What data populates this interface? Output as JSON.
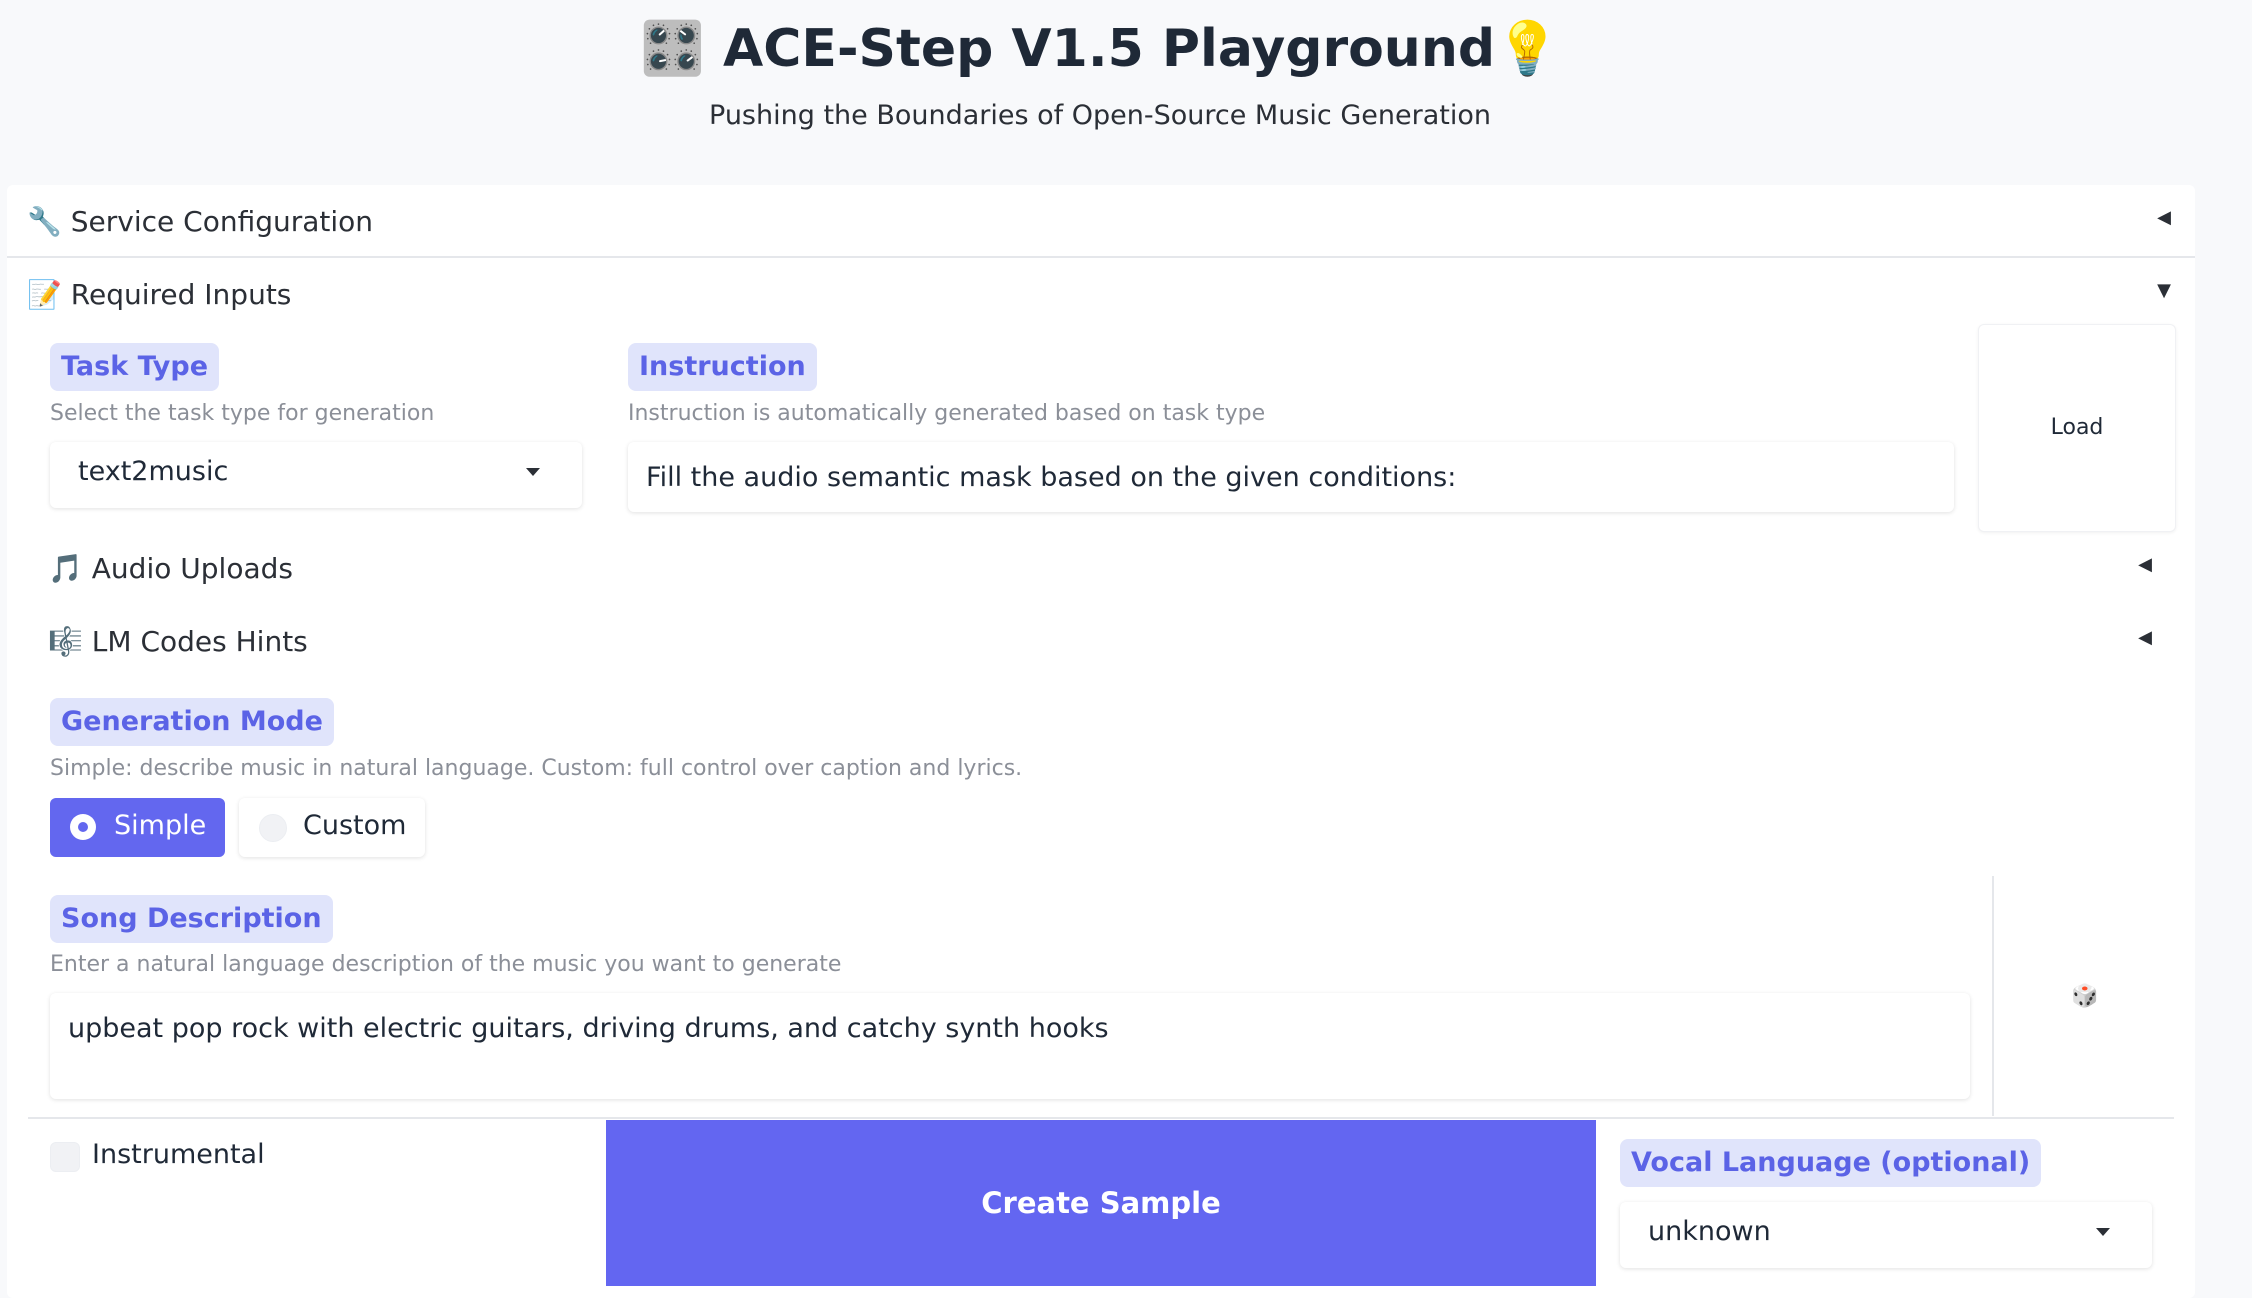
{
  "header": {
    "title_emoji": "🎛️",
    "title": "ACE-Step V1.5 Playground",
    "title_suffix_emoji": "💡",
    "subtitle": "Pushing the Boundaries of Open-Source Music Generation"
  },
  "accordions": {
    "service_config": {
      "icon": "🔧",
      "label": "Service Configuration",
      "arrow": "◀"
    },
    "required_inputs": {
      "icon": "📝",
      "label": "Required Inputs",
      "arrow": "▼"
    },
    "audio_uploads": {
      "icon": "🎵",
      "label": "Audio Uploads",
      "arrow": "◀"
    },
    "lm_codes_hints": {
      "icon": "🎼",
      "label": "LM Codes Hints",
      "arrow": "◀"
    }
  },
  "task_type": {
    "label": "Task Type",
    "hint": "Select the task type for generation",
    "value": "text2music"
  },
  "instruction": {
    "label": "Instruction",
    "hint": "Instruction is automatically generated based on task type",
    "value": "Fill the audio semantic mask based on the given conditions:"
  },
  "load_button": {
    "label": "Load"
  },
  "generation_mode": {
    "label": "Generation Mode",
    "hint": "Simple: describe music in natural language. Custom: full control over caption and lyrics.",
    "options": [
      "Simple",
      "Custom"
    ],
    "selected": "Simple"
  },
  "song_description": {
    "label": "Song Description",
    "hint": "Enter a natural language description of the music you want to generate",
    "value": "upbeat pop rock with electric guitars, driving drums, and catchy synth hooks"
  },
  "random_button": {
    "icon": "🎲"
  },
  "instrumental": {
    "label": "Instrumental",
    "checked": false
  },
  "create_sample": {
    "label": "Create Sample"
  },
  "vocal_language": {
    "label": "Vocal Language (optional)",
    "value": "unknown"
  },
  "colors": {
    "accent": "#6366f1",
    "badge_bg": "#e0e4fb",
    "badge_text": "#5b63e6"
  }
}
